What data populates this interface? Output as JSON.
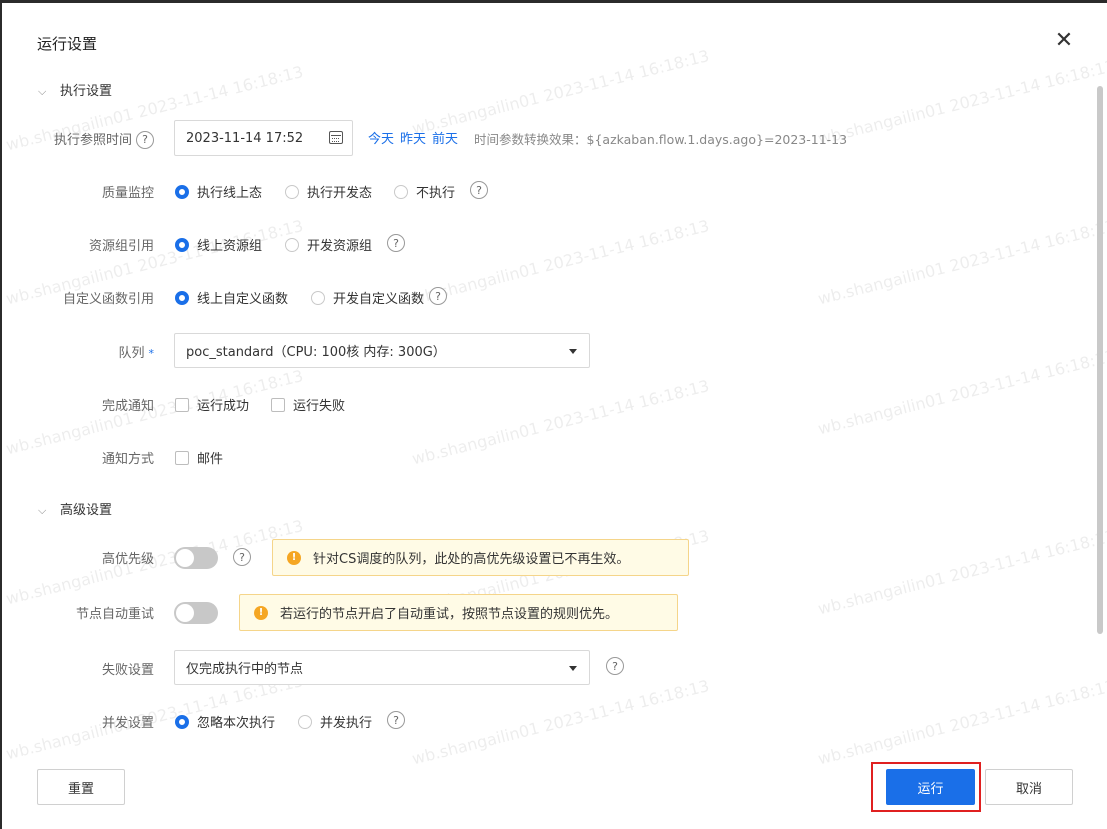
{
  "dialog": {
    "title": "运行设置",
    "close_icon": "close-icon"
  },
  "watermark": "wb.shangailin01 2023-11-14 16:18:13",
  "sections": {
    "exec": "执行设置",
    "advanced": "高级设置"
  },
  "fields": {
    "ref_time": {
      "label": "执行参照时间",
      "value": "2023-11-14 17:52",
      "links": [
        "今天",
        "昨天",
        "前天"
      ],
      "hint": "时间参数转换效果：${azkaban.flow.1.days.ago}=2023-11-13"
    },
    "quality": {
      "label": "质量监控",
      "options": [
        "执行线上态",
        "执行开发态",
        "不执行"
      ],
      "selected": "执行线上态"
    },
    "resource_group": {
      "label": "资源组引用",
      "options": [
        "线上资源组",
        "开发资源组"
      ],
      "selected": "线上资源组"
    },
    "udf": {
      "label": "自定义函数引用",
      "options": [
        "线上自定义函数",
        "开发自定义函数"
      ],
      "selected": "线上自定义函数"
    },
    "queue": {
      "label": "队列",
      "required_mark": "*",
      "value": "poc_standard（CPU: 100核 内存: 300G）"
    },
    "finish_notify": {
      "label": "完成通知",
      "options": [
        "运行成功",
        "运行失败"
      ]
    },
    "notify_method": {
      "label": "通知方式",
      "options": [
        "邮件"
      ]
    },
    "high_priority": {
      "label": "高优先级",
      "enabled": false,
      "notice": "针对CS调度的队列，此处的高优先级设置已不再生效。"
    },
    "auto_retry": {
      "label": "节点自动重试",
      "enabled": false,
      "notice": "若运行的节点开启了自动重试，按照节点设置的规则优先。"
    },
    "failure": {
      "label": "失败设置",
      "value": "仅完成执行中的节点"
    },
    "concurrency": {
      "label": "并发设置",
      "options": [
        "忽略本次执行",
        "并发执行"
      ],
      "selected": "忽略本次执行"
    }
  },
  "footer": {
    "reset": "重置",
    "run": "运行",
    "cancel": "取消"
  },
  "help_glyph": "?",
  "warn_glyph": "!",
  "colors": {
    "accent": "#1a6fe8",
    "warning": "#f5a623",
    "highlight_frame": "#e02020"
  }
}
